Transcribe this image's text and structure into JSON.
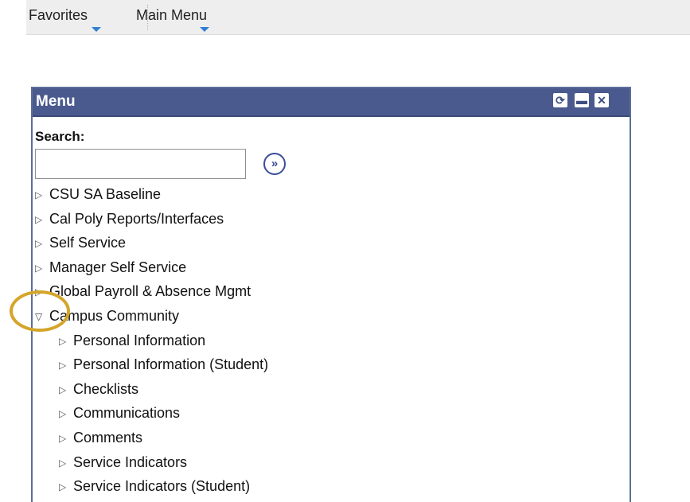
{
  "topbar": {
    "favorites_label": "Favorites",
    "main_menu_label": "Main Menu"
  },
  "menu": {
    "title": "Menu",
    "buttons": {
      "refresh_icon": "refresh-icon",
      "minimize_icon": "minimize-icon",
      "close_icon": "close-icon"
    },
    "search": {
      "label": "Search:",
      "value": "",
      "placeholder": "",
      "go_icon": "double-chevron-right-icon"
    },
    "items": [
      {
        "label": "CSU SA Baseline",
        "expanded": false,
        "level": 0
      },
      {
        "label": "Cal Poly Reports/Interfaces",
        "expanded": false,
        "level": 0
      },
      {
        "label": "Self Service",
        "expanded": false,
        "level": 0
      },
      {
        "label": "Manager Self Service",
        "expanded": false,
        "level": 0
      },
      {
        "label": "Global Payroll & Absence Mgmt",
        "expanded": false,
        "level": 0
      },
      {
        "label": "Campus Community",
        "expanded": true,
        "level": 0
      },
      {
        "label": "Personal Information",
        "expanded": false,
        "level": 1
      },
      {
        "label": "Personal Information (Student)",
        "expanded": false,
        "level": 1
      },
      {
        "label": "Checklists",
        "expanded": false,
        "level": 1
      },
      {
        "label": "Communications",
        "expanded": false,
        "level": 1
      },
      {
        "label": "Comments",
        "expanded": false,
        "level": 1
      },
      {
        "label": "Service Indicators",
        "expanded": false,
        "level": 1
      },
      {
        "label": "Service Indicators (Student)",
        "expanded": false,
        "level": 1
      }
    ]
  },
  "colors": {
    "header_bg": "#4a5a8e",
    "panel_border": "#5b6d9a",
    "nav_caret": "#2f7fd4",
    "highlight_ring": "#d4a52a"
  }
}
